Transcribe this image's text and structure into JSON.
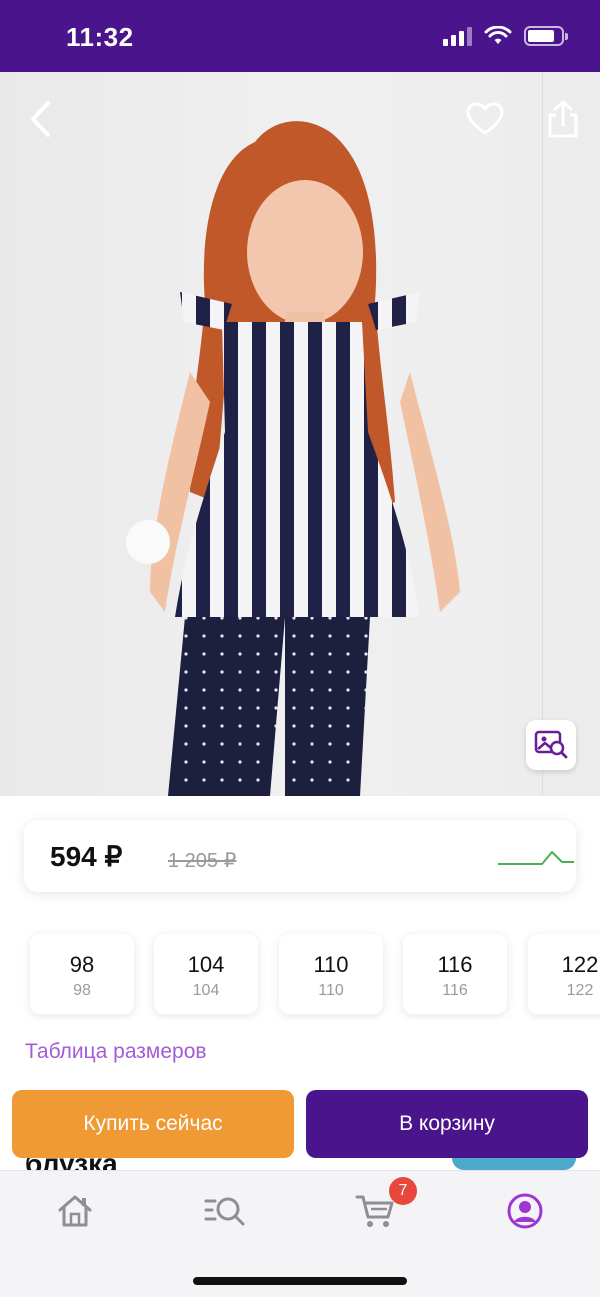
{
  "status_bar": {
    "time": "11:32"
  },
  "product": {
    "image_alt": "product-photo"
  },
  "price": {
    "current": "594 ₽",
    "old": "1 205 ₽",
    "trend_color": "#4caf50"
  },
  "sizes": [
    {
      "size": "98",
      "height": "98"
    },
    {
      "size": "104",
      "height": "104"
    },
    {
      "size": "110",
      "height": "110"
    },
    {
      "size": "116",
      "height": "116"
    },
    {
      "size": "122",
      "height": "122"
    }
  ],
  "size_table_link": "Таблица размеров",
  "peek_title": "блузка",
  "actions": {
    "buy_now": "Купить сейчас",
    "add_to_cart": "В корзину"
  },
  "tab_bar": {
    "cart_badge": "7"
  },
  "colors": {
    "brand": "#4a148c",
    "accent_orange": "#f09a36",
    "link": "#a35bd6",
    "badge": "#e8473d"
  }
}
